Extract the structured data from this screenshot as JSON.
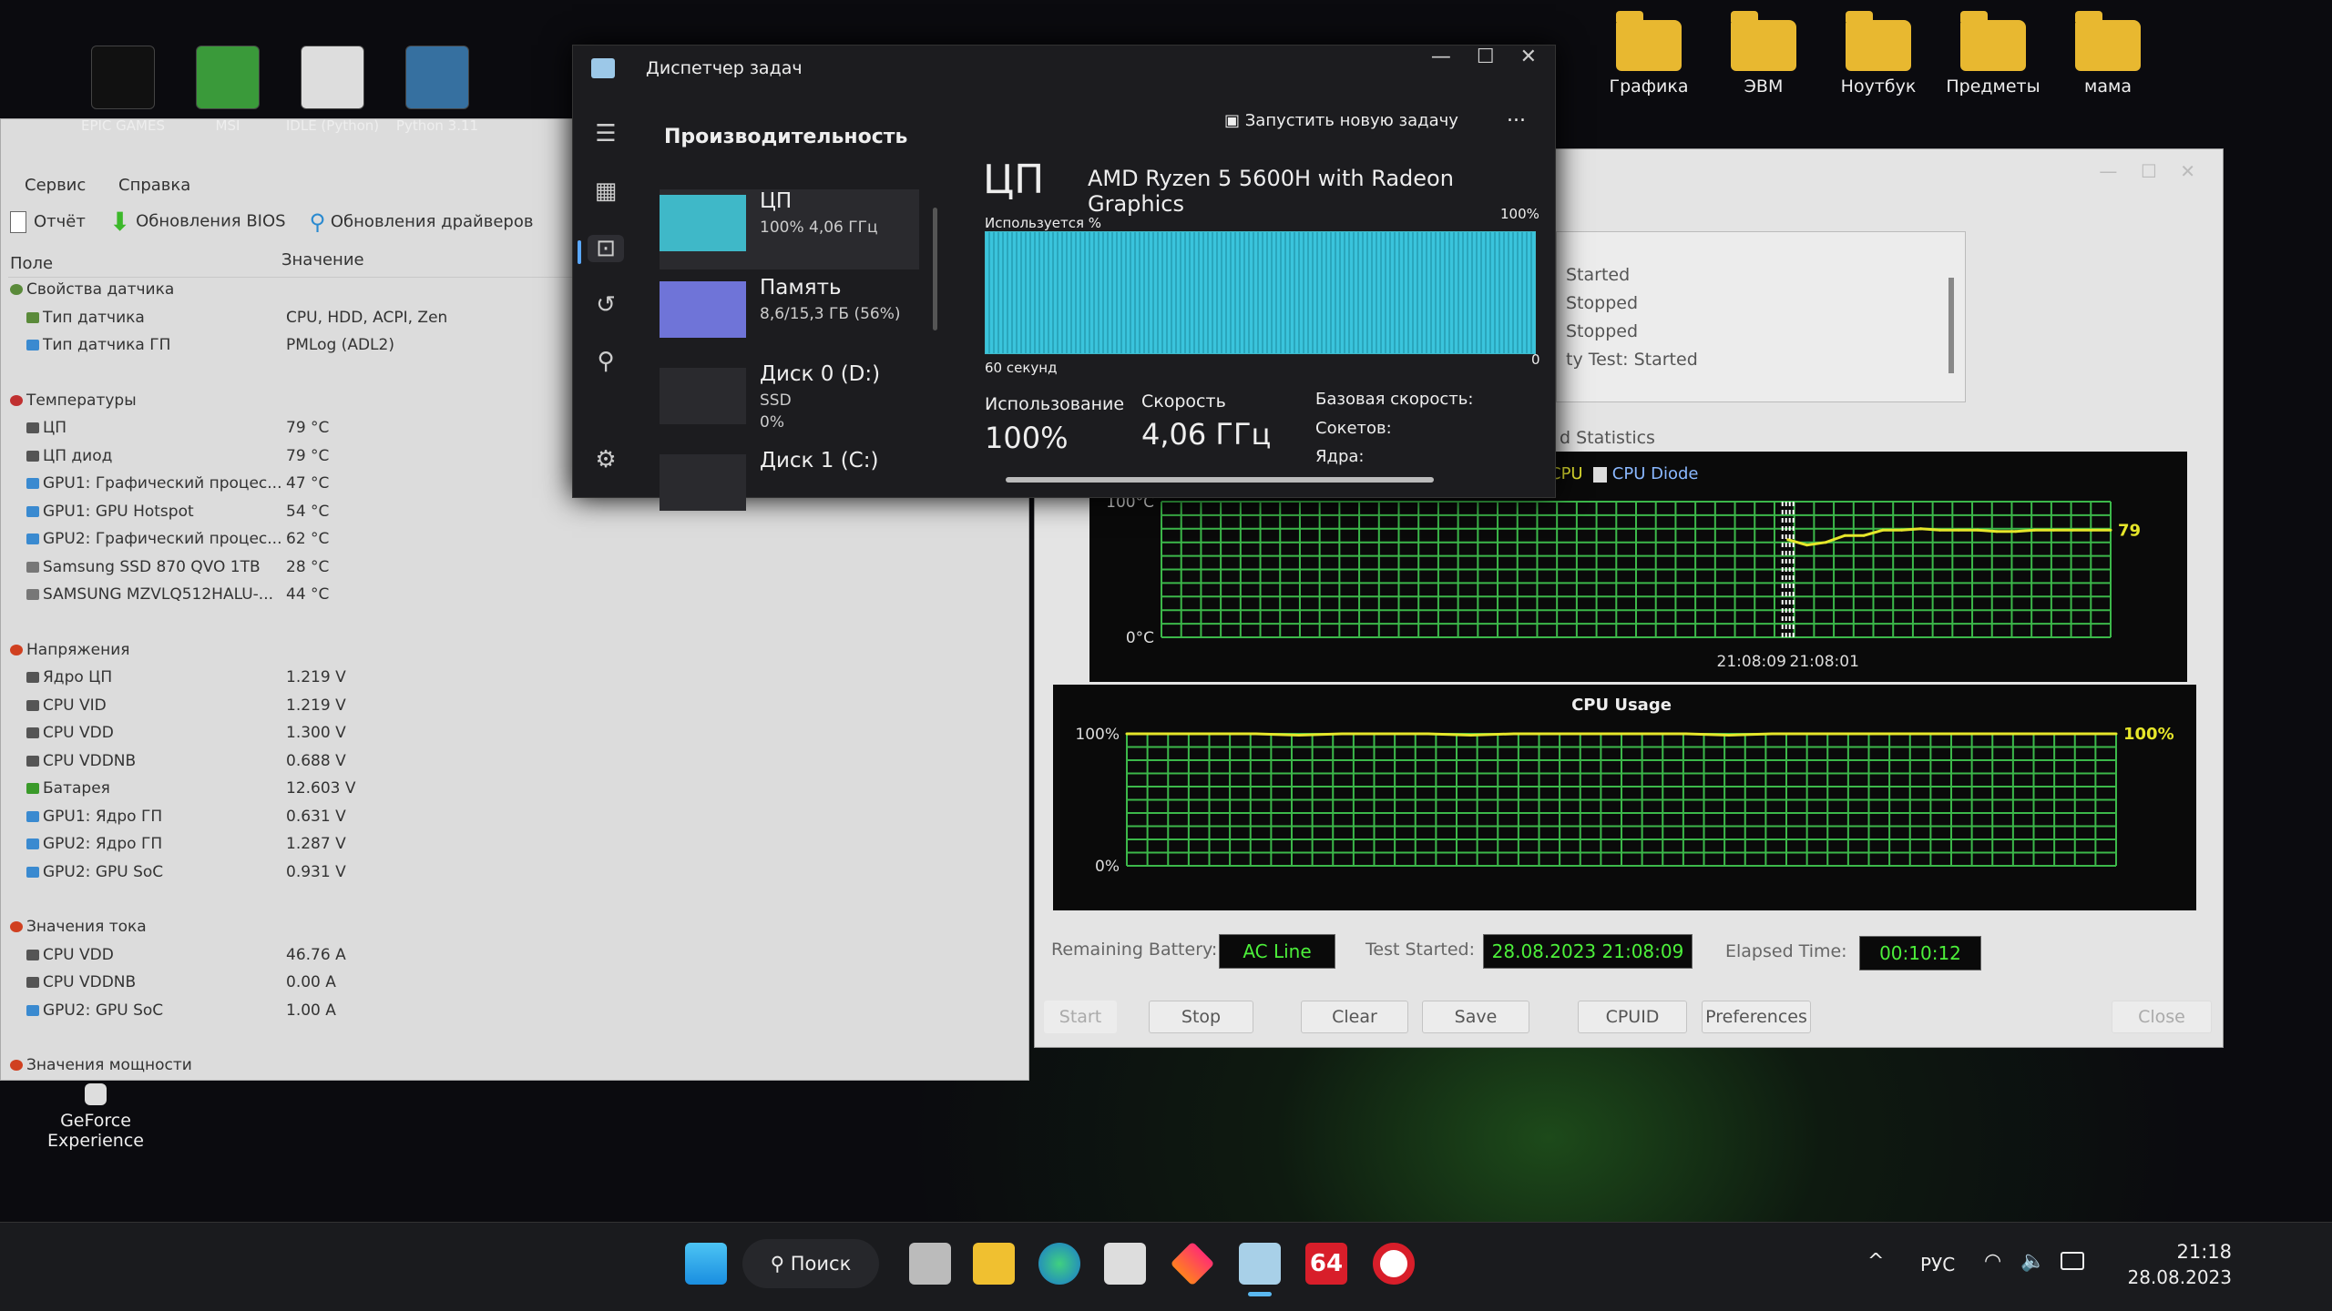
{
  "desktop": {
    "left_icons": [
      {
        "label": "EPIC GAMES",
        "color": "#111"
      },
      {
        "label": "MSI",
        "color": "#3a9a3a"
      },
      {
        "label": "IDLE (Python)",
        "color": "#ddd"
      },
      {
        "label": "Python 3.11",
        "color": "#3670a0"
      }
    ],
    "folders": [
      "Графика",
      "ЭВМ",
      "Ноутбук",
      "Предметы",
      "мама"
    ],
    "bottom_icon": "GeForce Experience"
  },
  "aida": {
    "menu": [
      "Сервис",
      "Справка"
    ],
    "toolbar": [
      "Отчёт",
      "Обновления BIOS",
      "Обновления драйверов"
    ],
    "columns": {
      "field": "Поле",
      "value": "Значение"
    },
    "rows": [
      {
        "type": "group",
        "name": "Свойства датчика",
        "icon": "sensor-icon"
      },
      {
        "name": "Тип датчика",
        "value": "CPU, HDD, ACPI, Zen",
        "icon": "sensor-icon"
      },
      {
        "name": "Тип датчика ГП",
        "value": "PMLog  (ADL2)",
        "icon": "gpu-icon"
      },
      {
        "type": "gap"
      },
      {
        "type": "group",
        "name": "Температуры",
        "icon": "thermometer-icon"
      },
      {
        "name": "ЦП",
        "value": "79 °C",
        "icon": "cpu-icon"
      },
      {
        "name": "ЦП диод",
        "value": "79 °C",
        "icon": "cpu-icon"
      },
      {
        "name": "GPU1: Графический процес...",
        "value": "47 °C",
        "icon": "gpu-icon"
      },
      {
        "name": "GPU1: GPU Hotspot",
        "value": "54 °C",
        "icon": "gpu-icon"
      },
      {
        "name": "GPU2: Графический процес...",
        "value": "62 °C",
        "icon": "gpu-icon"
      },
      {
        "name": "Samsung SSD 870 QVO 1TB",
        "value": "28 °C",
        "icon": "disk-icon"
      },
      {
        "name": "SAMSUNG MZVLQ512HALU-...",
        "value": "44 °C",
        "icon": "disk-icon"
      },
      {
        "type": "gap"
      },
      {
        "type": "group",
        "name": "Напряжения",
        "icon": "voltage-icon"
      },
      {
        "name": "Ядро ЦП",
        "value": "1.219 V",
        "icon": "cpu-icon"
      },
      {
        "name": "CPU VID",
        "value": "1.219 V",
        "icon": "cpu-icon"
      },
      {
        "name": "CPU VDD",
        "value": "1.300 V",
        "icon": "cpu-icon"
      },
      {
        "name": "CPU VDDNB",
        "value": "0.688 V",
        "icon": "cpu-icon"
      },
      {
        "name": "Батарея",
        "value": "12.603 V",
        "icon": "battery-icon"
      },
      {
        "name": "GPU1: Ядро ГП",
        "value": "0.631 V",
        "icon": "gpu-icon"
      },
      {
        "name": "GPU2: Ядро ГП",
        "value": "1.287 V",
        "icon": "gpu-icon"
      },
      {
        "name": "GPU2: GPU SoC",
        "value": "0.931 V",
        "icon": "gpu-icon"
      },
      {
        "type": "gap"
      },
      {
        "type": "group",
        "name": "Значения тока",
        "icon": "current-icon"
      },
      {
        "name": "CPU VDD",
        "value": "46.76 A",
        "icon": "cpu-icon"
      },
      {
        "name": "CPU VDDNB",
        "value": "0.00 A",
        "icon": "cpu-icon"
      },
      {
        "name": "GPU2: GPU SoC",
        "value": "1.00 A",
        "icon": "gpu-icon"
      },
      {
        "type": "gap"
      },
      {
        "type": "group",
        "name": "Значения мощности",
        "icon": "power-icon"
      }
    ]
  },
  "taskmgr": {
    "title": "Диспетчер задач",
    "section": "Производительность",
    "run_task": "Запустить новую задачу",
    "more": "...",
    "cards": [
      {
        "title": "ЦП",
        "line1": "100% 4,06 ГГц",
        "line2": "",
        "color": "#3fb8c8"
      },
      {
        "title": "Память",
        "line1": "8,6/15,3 ГБ (56%)",
        "line2": "",
        "color": "#6f74d8"
      },
      {
        "title": "Диск 0 (D:)",
        "line1": "SSD",
        "line2": "0%",
        "color": "#2a2a2e"
      },
      {
        "title": "Диск 1 (C:)",
        "line1": "",
        "line2": "",
        "color": "#2a2a2e"
      }
    ],
    "cpu_label": "ЦП",
    "cpu_name": "AMD Ryzen 5 5600H with Radeon Graphics",
    "graph_label": "Используется %",
    "graph_max": "100%",
    "graph_time": "60 секунд",
    "graph_min": "0",
    "usage_level_percent": 100,
    "usage_label": "Использование",
    "usage_value": "100%",
    "speed_label": "Скорость",
    "speed_value": "4,06 ГГц",
    "base_speed": "Базовая скорость:",
    "sockets": "Сокетов:",
    "cores": "Ядра:"
  },
  "stability": {
    "log": [
      "Started",
      "Stopped",
      "Stopped",
      "ty Test: Started"
    ],
    "tab": "d   Statistics",
    "legend": [
      {
        "label": "CPU",
        "color": "#e0e030"
      },
      {
        "label": "CPU Diode",
        "color": "#8ab8ff"
      }
    ],
    "status": {
      "battery_label": "Remaining Battery:",
      "battery": "AC Line",
      "started_label": "Test Started:",
      "started": "28.08.2023 21:08:09",
      "elapsed_label": "Elapsed Time:",
      "elapsed": "00:10:12"
    },
    "buttons": [
      "Start",
      "Stop",
      "Clear",
      "Save",
      "CPUID",
      "Preferences",
      "Close"
    ]
  },
  "chart_data": [
    {
      "type": "line",
      "title": "",
      "yunit": "°C",
      "ylim": [
        0,
        100
      ],
      "ytick_labels": [
        "100°C",
        "0°C"
      ],
      "xtick_labels": [
        "21:08:09",
        "21:08:01"
      ],
      "grid": true,
      "series": [
        {
          "name": "CPU Diode",
          "color": "#e6e62a",
          "values": [
            72,
            68,
            70,
            75,
            75,
            79,
            79,
            80,
            79,
            79,
            79,
            78,
            78,
            79,
            79,
            79,
            79,
            79
          ],
          "end_label": "79"
        }
      ]
    },
    {
      "type": "line",
      "title": "CPU Usage",
      "ylim": [
        0,
        100
      ],
      "ytick_labels": [
        "100%",
        "0%"
      ],
      "grid": true,
      "series": [
        {
          "color": "#e6e62a",
          "values": [
            100,
            100,
            100,
            100,
            99,
            100,
            100,
            100,
            99,
            100,
            100,
            100,
            100,
            100,
            99,
            100,
            100,
            100,
            100,
            100,
            100,
            100,
            100,
            100
          ],
          "end_label": "100%"
        }
      ]
    }
  ],
  "taskbar": {
    "search": "Поиск",
    "lang": "РУС",
    "time": "21:18",
    "date": "28.08.2023",
    "chevron": "^"
  }
}
